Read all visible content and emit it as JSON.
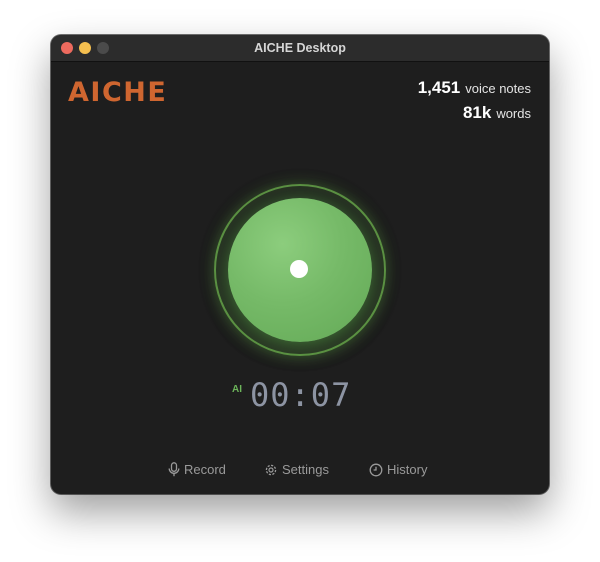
{
  "window": {
    "title": "AICHE Desktop"
  },
  "app": {
    "logo": "AICHE"
  },
  "stats": {
    "notes_count": "1,451",
    "notes_label": "voice notes",
    "words_count": "81k",
    "words_label": "words"
  },
  "recorder": {
    "ai_label": "AI",
    "timer": "00:07"
  },
  "nav": {
    "record_label": "Record",
    "settings_label": "Settings",
    "history_label": "History"
  },
  "colors": {
    "brand": "#cf6630",
    "record_green": "#76ba68",
    "background": "#1e1e1e"
  },
  "icons": [
    "microphone-icon",
    "gear-icon",
    "clock-icon"
  ]
}
